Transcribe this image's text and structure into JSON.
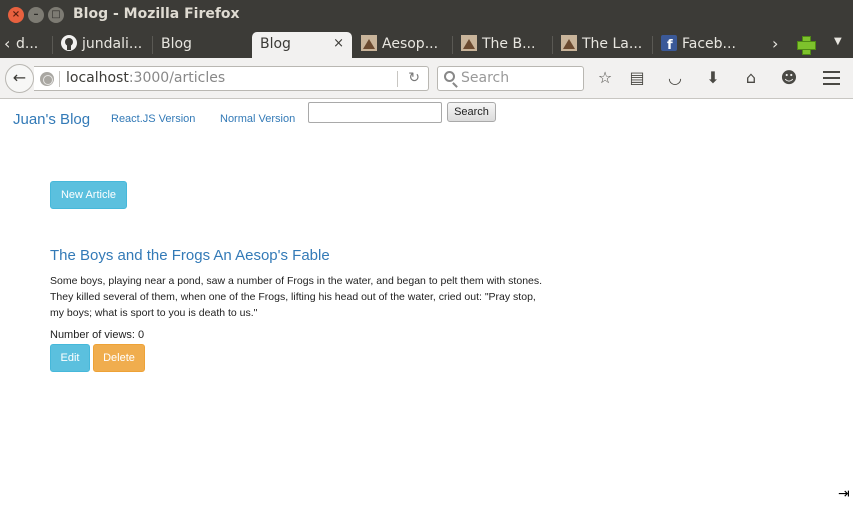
{
  "window": {
    "title": "Blog - Mozilla Firefox"
  },
  "tabs": [
    {
      "label": "d...",
      "favicon": "none"
    },
    {
      "label": "jundali...",
      "favicon": "github-icon"
    },
    {
      "label": "Blog",
      "favicon": "none"
    },
    {
      "label": "Blog",
      "favicon": "none",
      "active": true
    },
    {
      "label": "Aesop...",
      "favicon": "fable-image-icon"
    },
    {
      "label": "The B...",
      "favicon": "fable-image-icon"
    },
    {
      "label": "The La...",
      "favicon": "fable-image-icon"
    },
    {
      "label": "Faceb...",
      "favicon": "facebook-icon"
    }
  ],
  "tab_close": "×",
  "toolbar": {
    "back": "←",
    "url_host": "localhost",
    "url_path": ":3000/articles",
    "reload": "↻",
    "search_placeholder": "Search",
    "bookmark": "☆",
    "reading_list": "▤",
    "pocket": "◡",
    "download": "⬇",
    "home": "⌂",
    "chat": "☻"
  },
  "page": {
    "brand": "Juan's Blog",
    "nav_links": [
      "React.JS Version",
      "Normal Version"
    ],
    "search_value": "",
    "search_button": "Search",
    "new_article_button": "New Article",
    "article": {
      "title": "The Boys and the Frogs An Aesop's Fable",
      "body": "Some boys, playing near a pond, saw a number of Frogs in the water, and began to pelt them with stones. They killed several of them, when one of the Frogs, lifting his head out of the water, cried out: \"Pray stop, my boys; what is sport to you is death to us.\"",
      "views_label": "Number of views: 0",
      "edit_button": "Edit",
      "delete_button": "Delete"
    }
  },
  "colors": {
    "link": "#337ab7",
    "info": "#5bc0de",
    "warning": "#f0ad4e",
    "chrome_dark": "#3c3b37"
  }
}
